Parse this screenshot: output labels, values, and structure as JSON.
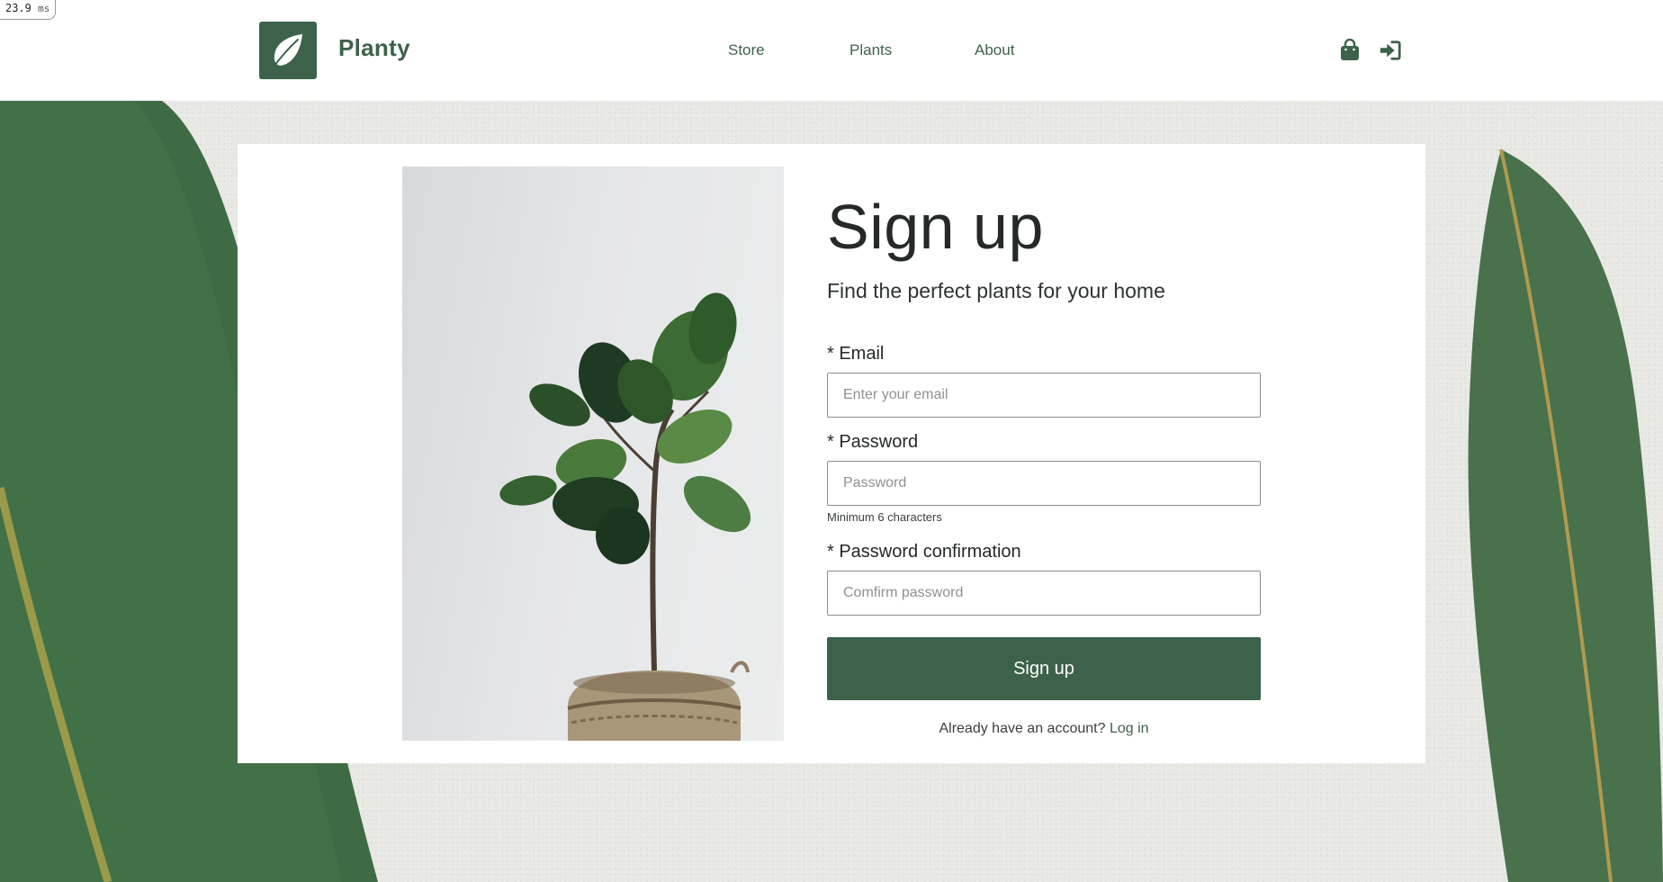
{
  "perf": {
    "value": "23.9",
    "unit": "ms"
  },
  "header": {
    "brand": "Planty",
    "nav": {
      "store": "Store",
      "plants": "Plants",
      "about": "About"
    },
    "icons": {
      "cart": "shopping-bag-icon",
      "login": "sign-in-icon"
    }
  },
  "signup": {
    "title": "Sign up",
    "subtitle": "Find the perfect plants for your home",
    "email": {
      "label": "* Email",
      "placeholder": "Enter your email",
      "value": ""
    },
    "password": {
      "label": "* Password",
      "placeholder": "Password",
      "value": "",
      "hint": "Minimum 6 characters"
    },
    "password_confirmation": {
      "label": "* Password confirmation",
      "placeholder": "Comfirm password",
      "value": ""
    },
    "submit_label": "Sign up",
    "already_text": "Already have an account?",
    "login_link": "Log in"
  },
  "colors": {
    "brand": "#3d624a",
    "text": "#25292a",
    "background": "#e7e8e3"
  }
}
